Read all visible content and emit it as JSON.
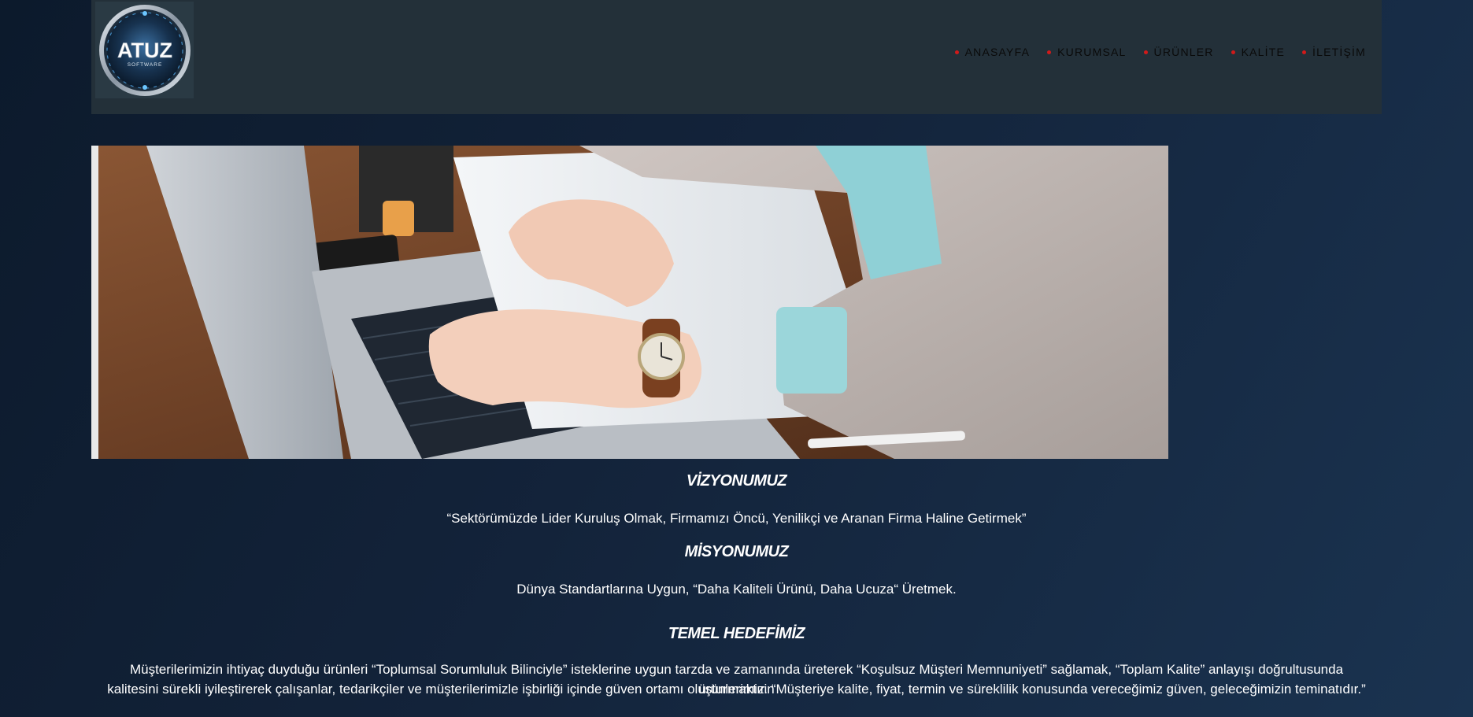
{
  "brand": {
    "logo_text": "ATUZ",
    "logo_subtext": "SOFTWARE"
  },
  "nav": {
    "items": [
      {
        "label": "ANASAYFA"
      },
      {
        "label": "KURUMSAL"
      },
      {
        "label": "ÜRÜNLER"
      },
      {
        "label": "KALİTE"
      },
      {
        "label": "İLETİŞİM"
      }
    ]
  },
  "colors": {
    "nav_dot": "#d11a1a",
    "header_bg": "#233039",
    "page_bg": "#13233a"
  },
  "sections": {
    "vision": {
      "title": "VİZYONUMUZ",
      "text": "“Sektörümüzde Lider Kuruluş Olmak, Firmamızı Öncü, Yenilikçi ve Aranan Firma Haline Getirmek”"
    },
    "mission": {
      "title": "MİSYONUMUZ",
      "text": "Dünya Standartlarına Uygun, “Daha Kaliteli Ürünü, Daha Ucuza“ Üretmek."
    },
    "goal": {
      "title": "TEMEL HEDEFİMİZ",
      "text_line1": "Müşterilerimizin ihtiyaç duyduğu ürünleri “Toplumsal Sorumluluk Bilinciyle” isteklerine uygun tarzda ve zamanında üreterek “Koşulsuz Müşteri Memnuniyeti” sağlamak, “Toplam Kalite” anlayışı doğrultusunda ürünlerimizin",
      "text_line2": "kalitesini sürekli iyileştirerek çalışanlar, tedarikçiler ve müşterilerimizle işbirliği içinde güven ortamı oluşturmaktır. “Müşteriye kalite, fiyat, termin ve süreklilik konusunda vereceğimiz güven, geleceğimizin teminatıdır.”"
    }
  }
}
